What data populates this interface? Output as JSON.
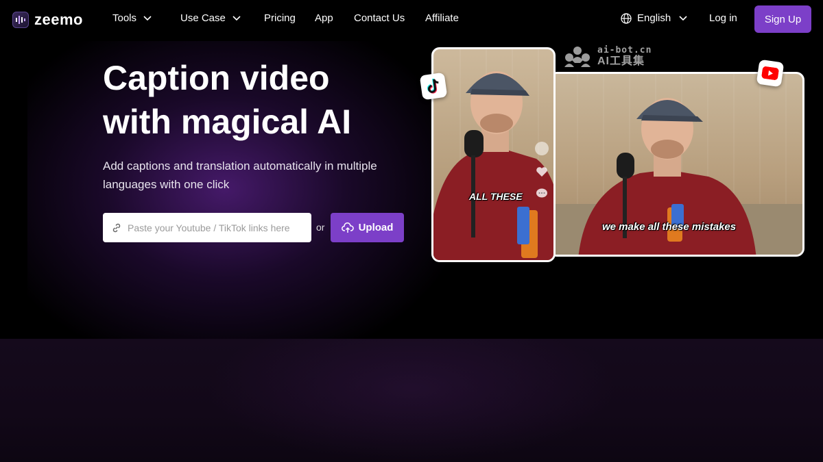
{
  "nav": {
    "logo_text": "zeemo",
    "tools_label": "Tools",
    "use_case_label": "Use Case",
    "pricing_label": "Pricing",
    "app_label": "App",
    "contact_label": "Contact Us",
    "affiliate_label": "Affiliate",
    "language_label": "English",
    "login_label": "Log in",
    "signup_label": "Sign Up"
  },
  "hero": {
    "title_line1": "Caption video",
    "title_line2": "with magical AI",
    "subtitle": "Add captions and translation automatically in multiple languages with one click",
    "search_placeholder": "Paste your Youtube / TikTok links here",
    "or_text": "or",
    "upload_label": "Upload"
  },
  "videos": {
    "tall_caption": "ALL THESE",
    "wide_caption": "we make all these mistakes"
  },
  "watermark": {
    "line1": "ai-bot.cn",
    "line2": "AI工具集"
  },
  "colors": {
    "accent": "#7c3fc8",
    "background": "#000000"
  },
  "icons": [
    "logo-icon",
    "chevron-down-icon",
    "globe-icon",
    "link-icon",
    "cloud-upload-icon",
    "tiktok-icon",
    "youtube-icon",
    "heart-icon",
    "comment-icon"
  ]
}
